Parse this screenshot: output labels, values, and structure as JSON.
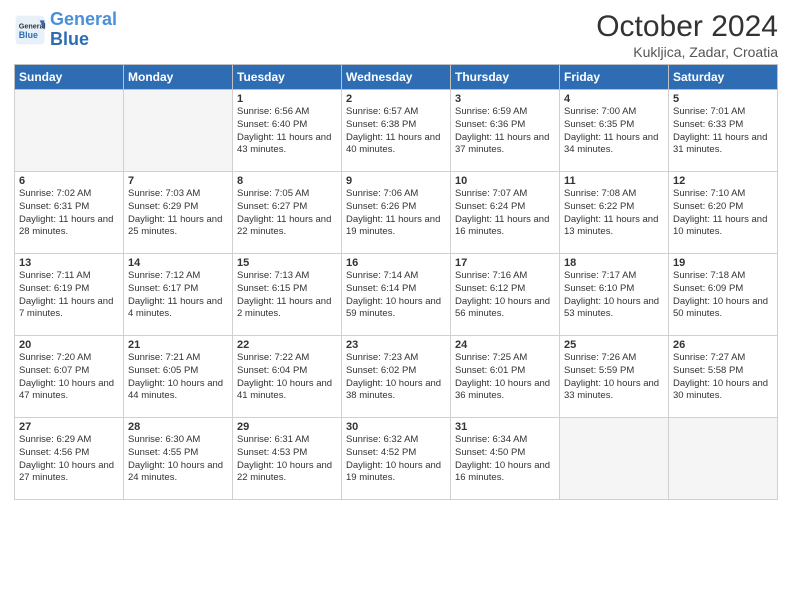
{
  "header": {
    "logo_general": "General",
    "logo_blue": "Blue",
    "month": "October 2024",
    "location": "Kukljica, Zadar, Croatia"
  },
  "weekdays": [
    "Sunday",
    "Monday",
    "Tuesday",
    "Wednesday",
    "Thursday",
    "Friday",
    "Saturday"
  ],
  "weeks": [
    [
      {
        "day": "",
        "info": "",
        "empty": true
      },
      {
        "day": "",
        "info": "",
        "empty": true
      },
      {
        "day": "1",
        "info": "Sunrise: 6:56 AM\nSunset: 6:40 PM\nDaylight: 11 hours and 43 minutes."
      },
      {
        "day": "2",
        "info": "Sunrise: 6:57 AM\nSunset: 6:38 PM\nDaylight: 11 hours and 40 minutes."
      },
      {
        "day": "3",
        "info": "Sunrise: 6:59 AM\nSunset: 6:36 PM\nDaylight: 11 hours and 37 minutes."
      },
      {
        "day": "4",
        "info": "Sunrise: 7:00 AM\nSunset: 6:35 PM\nDaylight: 11 hours and 34 minutes."
      },
      {
        "day": "5",
        "info": "Sunrise: 7:01 AM\nSunset: 6:33 PM\nDaylight: 11 hours and 31 minutes."
      }
    ],
    [
      {
        "day": "6",
        "info": "Sunrise: 7:02 AM\nSunset: 6:31 PM\nDaylight: 11 hours and 28 minutes."
      },
      {
        "day": "7",
        "info": "Sunrise: 7:03 AM\nSunset: 6:29 PM\nDaylight: 11 hours and 25 minutes."
      },
      {
        "day": "8",
        "info": "Sunrise: 7:05 AM\nSunset: 6:27 PM\nDaylight: 11 hours and 22 minutes."
      },
      {
        "day": "9",
        "info": "Sunrise: 7:06 AM\nSunset: 6:26 PM\nDaylight: 11 hours and 19 minutes."
      },
      {
        "day": "10",
        "info": "Sunrise: 7:07 AM\nSunset: 6:24 PM\nDaylight: 11 hours and 16 minutes."
      },
      {
        "day": "11",
        "info": "Sunrise: 7:08 AM\nSunset: 6:22 PM\nDaylight: 11 hours and 13 minutes."
      },
      {
        "day": "12",
        "info": "Sunrise: 7:10 AM\nSunset: 6:20 PM\nDaylight: 11 hours and 10 minutes."
      }
    ],
    [
      {
        "day": "13",
        "info": "Sunrise: 7:11 AM\nSunset: 6:19 PM\nDaylight: 11 hours and 7 minutes."
      },
      {
        "day": "14",
        "info": "Sunrise: 7:12 AM\nSunset: 6:17 PM\nDaylight: 11 hours and 4 minutes."
      },
      {
        "day": "15",
        "info": "Sunrise: 7:13 AM\nSunset: 6:15 PM\nDaylight: 11 hours and 2 minutes."
      },
      {
        "day": "16",
        "info": "Sunrise: 7:14 AM\nSunset: 6:14 PM\nDaylight: 10 hours and 59 minutes."
      },
      {
        "day": "17",
        "info": "Sunrise: 7:16 AM\nSunset: 6:12 PM\nDaylight: 10 hours and 56 minutes."
      },
      {
        "day": "18",
        "info": "Sunrise: 7:17 AM\nSunset: 6:10 PM\nDaylight: 10 hours and 53 minutes."
      },
      {
        "day": "19",
        "info": "Sunrise: 7:18 AM\nSunset: 6:09 PM\nDaylight: 10 hours and 50 minutes."
      }
    ],
    [
      {
        "day": "20",
        "info": "Sunrise: 7:20 AM\nSunset: 6:07 PM\nDaylight: 10 hours and 47 minutes."
      },
      {
        "day": "21",
        "info": "Sunrise: 7:21 AM\nSunset: 6:05 PM\nDaylight: 10 hours and 44 minutes."
      },
      {
        "day": "22",
        "info": "Sunrise: 7:22 AM\nSunset: 6:04 PM\nDaylight: 10 hours and 41 minutes."
      },
      {
        "day": "23",
        "info": "Sunrise: 7:23 AM\nSunset: 6:02 PM\nDaylight: 10 hours and 38 minutes."
      },
      {
        "day": "24",
        "info": "Sunrise: 7:25 AM\nSunset: 6:01 PM\nDaylight: 10 hours and 36 minutes."
      },
      {
        "day": "25",
        "info": "Sunrise: 7:26 AM\nSunset: 5:59 PM\nDaylight: 10 hours and 33 minutes."
      },
      {
        "day": "26",
        "info": "Sunrise: 7:27 AM\nSunset: 5:58 PM\nDaylight: 10 hours and 30 minutes."
      }
    ],
    [
      {
        "day": "27",
        "info": "Sunrise: 6:29 AM\nSunset: 4:56 PM\nDaylight: 10 hours and 27 minutes."
      },
      {
        "day": "28",
        "info": "Sunrise: 6:30 AM\nSunset: 4:55 PM\nDaylight: 10 hours and 24 minutes."
      },
      {
        "day": "29",
        "info": "Sunrise: 6:31 AM\nSunset: 4:53 PM\nDaylight: 10 hours and 22 minutes."
      },
      {
        "day": "30",
        "info": "Sunrise: 6:32 AM\nSunset: 4:52 PM\nDaylight: 10 hours and 19 minutes."
      },
      {
        "day": "31",
        "info": "Sunrise: 6:34 AM\nSunset: 4:50 PM\nDaylight: 10 hours and 16 minutes."
      },
      {
        "day": "",
        "info": "",
        "empty": true
      },
      {
        "day": "",
        "info": "",
        "empty": true
      }
    ]
  ]
}
